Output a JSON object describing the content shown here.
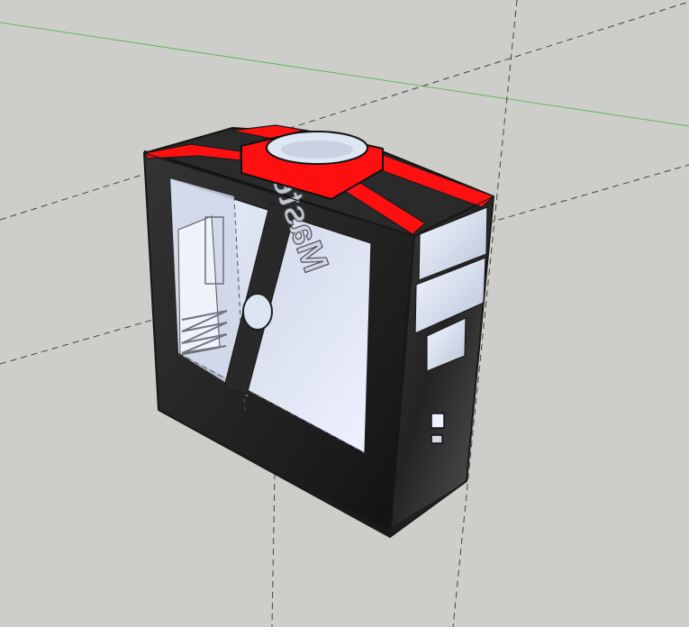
{
  "viewport": {
    "background": "#cdcdc9",
    "mode": "3d-modeling-viewport"
  },
  "axes": {
    "green_axis_color": "#55b84e",
    "red_axis_color": "#9b2b2b",
    "blue_axis_color": "#4c59b7"
  },
  "model": {
    "body_color": "#222222",
    "accent_color": "#ff1010",
    "window_color": "#dfe6f4",
    "interior_color": "#cfd7e8",
    "logo_text": "Master"
  }
}
